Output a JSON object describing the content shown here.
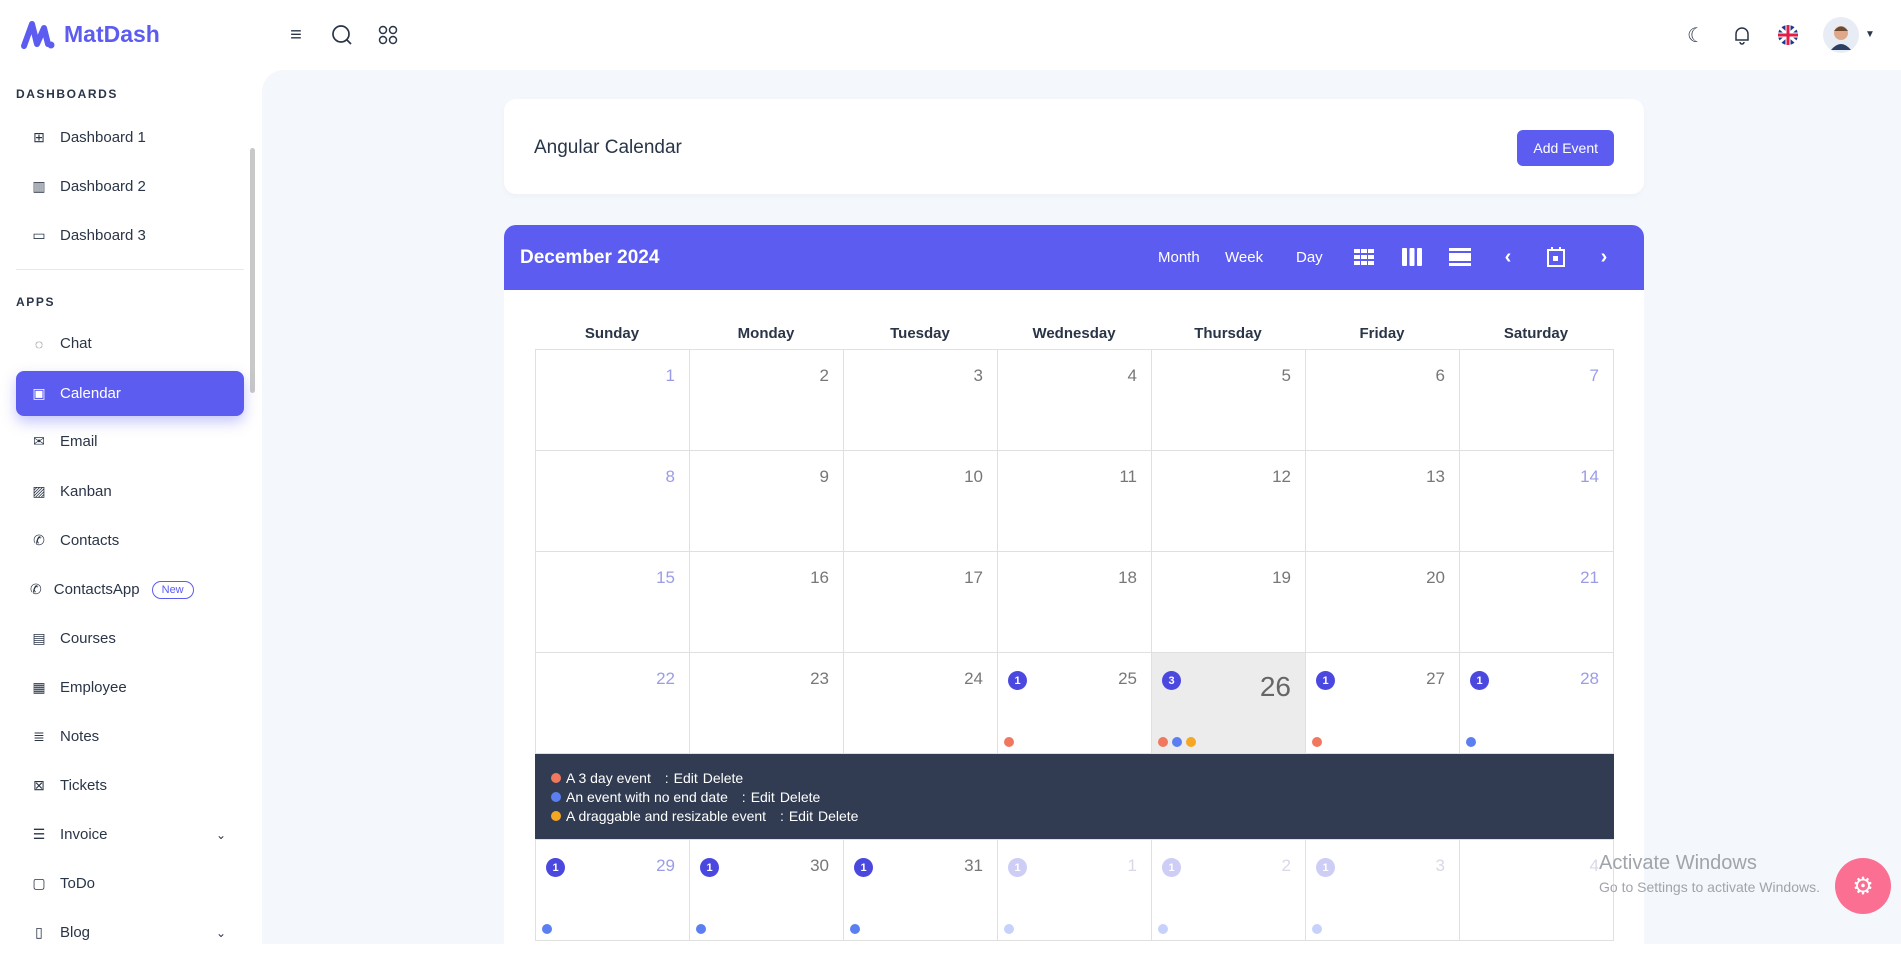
{
  "brand": {
    "name": "MatDash"
  },
  "sidebar": {
    "sections": [
      {
        "label": "DASHBOARDS"
      },
      {
        "label": "APPS"
      }
    ],
    "items": [
      {
        "label": "Dashboard 1",
        "icon": "apps-plus-icon",
        "sym": "⊞"
      },
      {
        "label": "Dashboard 2",
        "icon": "chart-bar-icon",
        "sym": "▥"
      },
      {
        "label": "Dashboard 3",
        "icon": "screen-share-icon",
        "sym": "▭"
      },
      {
        "label": "Chat",
        "icon": "message-icon",
        "sym": "◌"
      },
      {
        "label": "Calendar",
        "icon": "calendar-icon",
        "sym": "▣",
        "active": true
      },
      {
        "label": "Email",
        "icon": "mail-icon",
        "sym": "✉"
      },
      {
        "label": "Kanban",
        "icon": "kanban-icon",
        "sym": "▨"
      },
      {
        "label": "Contacts",
        "icon": "phone-icon",
        "sym": "✆"
      },
      {
        "label": "ContactsApp",
        "icon": "phone-icon",
        "sym": "✆",
        "badge": "New"
      },
      {
        "label": "Courses",
        "icon": "book-icon",
        "sym": "▤"
      },
      {
        "label": "Employee",
        "icon": "id-card-icon",
        "sym": "▦"
      },
      {
        "label": "Notes",
        "icon": "notes-icon",
        "sym": "≣"
      },
      {
        "label": "Tickets",
        "icon": "ticket-icon",
        "sym": "⊠"
      },
      {
        "label": "Invoice",
        "icon": "invoice-icon",
        "sym": "☰",
        "chevron": true
      },
      {
        "label": "ToDo",
        "icon": "checkbox-icon",
        "sym": "▢"
      },
      {
        "label": "Blog",
        "icon": "blog-icon",
        "sym": "▯",
        "chevron": true
      }
    ]
  },
  "page": {
    "title": "Angular Calendar",
    "add_event": "Add Event"
  },
  "calendar": {
    "title": "December 2024",
    "views": [
      "Month",
      "Week",
      "Day"
    ],
    "weekdays": [
      "Sunday",
      "Monday",
      "Tuesday",
      "Wednesday",
      "Thursday",
      "Friday",
      "Saturday"
    ],
    "colors": {
      "red": "#f0785f",
      "blue": "#5b7ff0",
      "yellow": "#f5a623",
      "accent": "#5d5cf0"
    },
    "weeks": [
      [
        {
          "n": "1"
        },
        {
          "n": "2"
        },
        {
          "n": "3"
        },
        {
          "n": "4"
        },
        {
          "n": "5"
        },
        {
          "n": "6"
        },
        {
          "n": "7"
        }
      ],
      [
        {
          "n": "8"
        },
        {
          "n": "9"
        },
        {
          "n": "10"
        },
        {
          "n": "11"
        },
        {
          "n": "12"
        },
        {
          "n": "13"
        },
        {
          "n": "14"
        }
      ],
      [
        {
          "n": "15"
        },
        {
          "n": "16"
        },
        {
          "n": "17"
        },
        {
          "n": "18"
        },
        {
          "n": "19"
        },
        {
          "n": "20"
        },
        {
          "n": "21"
        }
      ],
      [
        {
          "n": "22"
        },
        {
          "n": "23"
        },
        {
          "n": "24"
        },
        {
          "n": "25",
          "badge": "1",
          "dots": [
            "red"
          ]
        },
        {
          "n": "26",
          "badge": "3",
          "dots": [
            "red",
            "blue",
            "yellow"
          ],
          "today": true
        },
        {
          "n": "27",
          "badge": "1",
          "dots": [
            "red"
          ]
        },
        {
          "n": "28",
          "badge": "1",
          "dots": [
            "blue"
          ]
        }
      ],
      [
        {
          "n": "29",
          "badge": "1",
          "dots": [
            "blue"
          ]
        },
        {
          "n": "30",
          "badge": "1",
          "dots": [
            "blue"
          ]
        },
        {
          "n": "31",
          "badge": "1",
          "dots": [
            "blue"
          ]
        },
        {
          "n": "1",
          "badge": "1",
          "dots": [
            "blue"
          ],
          "other": true
        },
        {
          "n": "2",
          "badge": "1",
          "dots": [
            "blue"
          ],
          "other": true
        },
        {
          "n": "3",
          "badge": "1",
          "dots": [
            "blue"
          ],
          "other": true
        },
        {
          "n": "4",
          "other": true
        }
      ]
    ],
    "open_events": [
      {
        "title": "A 3 day event",
        "color": "red"
      },
      {
        "title": "An event with no end date",
        "color": "blue"
      },
      {
        "title": "A draggable and resizable event",
        "color": "yellow"
      }
    ],
    "edit_label": "Edit",
    "delete_label": "Delete",
    "separator": ":"
  },
  "watermark": {
    "line1": "Activate Windows",
    "line2": "Go to Settings to activate Windows."
  }
}
